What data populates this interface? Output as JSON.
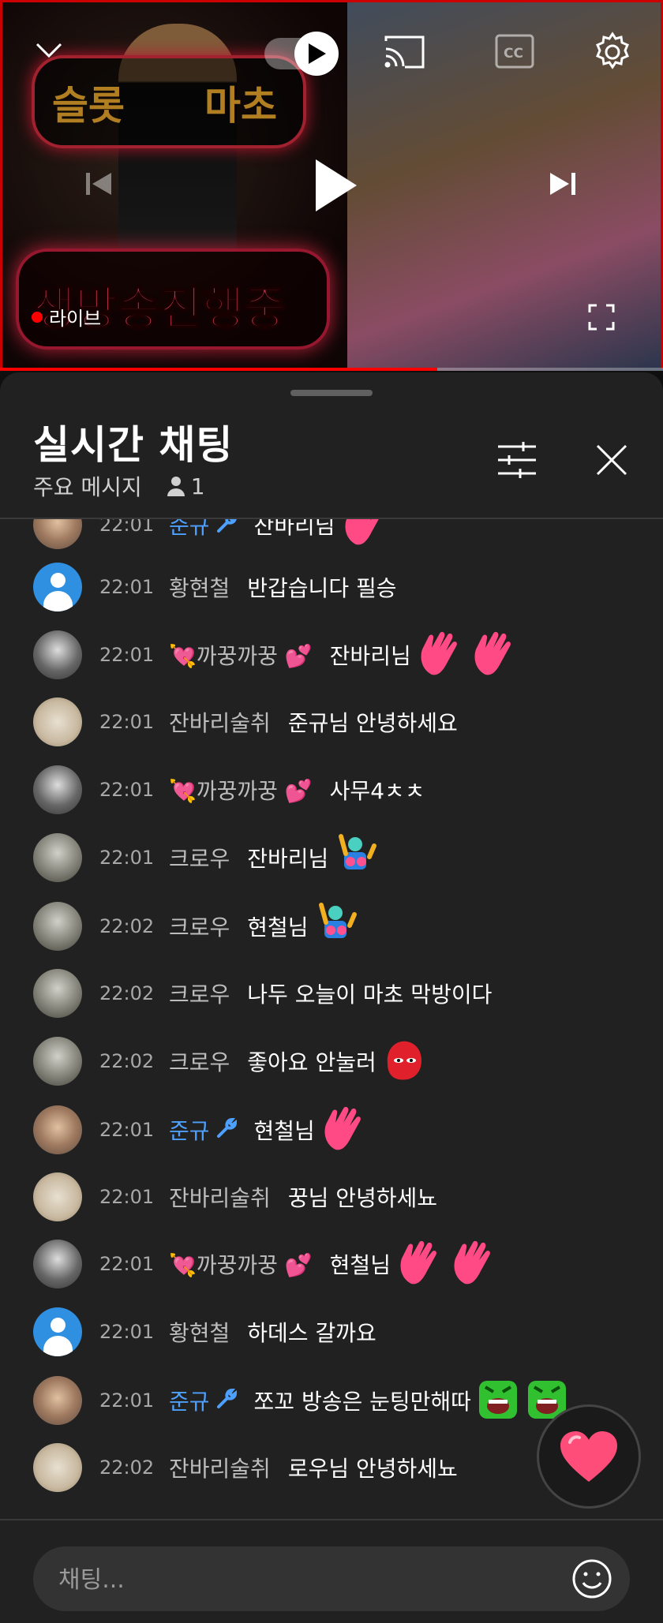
{
  "player": {
    "thumbnail_text_top_left": "슬롯",
    "thumbnail_text_top_right": "마초",
    "thumbnail_text_bottom": "생방송진행중",
    "live_label": "라이브",
    "progress": 0.66,
    "icons": [
      "chevron-down-icon",
      "autoplay-toggle",
      "cast-icon",
      "captions-icon",
      "settings-icon",
      "previous-icon",
      "play-icon",
      "next-icon",
      "fullscreen-icon"
    ]
  },
  "chat": {
    "title": "실시간 채팅",
    "mode_label": "주요 메시지",
    "viewer_count": "1",
    "input_placeholder": "채팅...",
    "messages": [
      {
        "avatar": "av-e",
        "time": "22:01",
        "author": "준규",
        "mod": true,
        "text": "잔바리님",
        "emoji": [
          "wave-hand-emoji"
        ]
      },
      {
        "avatar": "av-default",
        "time": "22:01",
        "author": "황현철",
        "mod": false,
        "text": "반갑습니다 필승",
        "emoji": []
      },
      {
        "avatar": "av-c",
        "time": "22:01",
        "author": "💘까꿍까꿍 💕",
        "mod": false,
        "text": "잔바리님",
        "emoji": [
          "wave-hand-emoji",
          "wave-hand-emoji"
        ]
      },
      {
        "avatar": "av-b",
        "time": "22:01",
        "author": "잔바리술취",
        "mod": false,
        "text": "준규님 안녕하세요",
        "emoji": []
      },
      {
        "avatar": "av-c",
        "time": "22:01",
        "author": "💘까꿍까꿍 💕",
        "mod": false,
        "text": "사무4ㅊㅊ",
        "emoji": []
      },
      {
        "avatar": "av-d",
        "time": "22:01",
        "author": "크로우",
        "mod": false,
        "text": "잔바리님",
        "emoji": [
          "dancing-person-emoji"
        ]
      },
      {
        "avatar": "av-d",
        "time": "22:02",
        "author": "크로우",
        "mod": false,
        "text": "현철님",
        "emoji": [
          "dancing-person-emoji"
        ]
      },
      {
        "avatar": "av-d",
        "time": "22:02",
        "author": "크로우",
        "mod": false,
        "text": "나두 오늘이 마초 막방이다",
        "emoji": []
      },
      {
        "avatar": "av-d",
        "time": "22:02",
        "author": "크로우",
        "mod": false,
        "text": "좋아요 안눌러",
        "emoji": [
          "red-blob-emoji"
        ]
      },
      {
        "avatar": "av-e",
        "time": "22:01",
        "author": "준규",
        "mod": true,
        "text": "현철님",
        "emoji": [
          "wave-hand-emoji"
        ]
      },
      {
        "avatar": "av-b",
        "time": "22:01",
        "author": "잔바리술취",
        "mod": false,
        "text": "꿍님 안녕하세뇨",
        "emoji": []
      },
      {
        "avatar": "av-c",
        "time": "22:01",
        "author": "💘까꿍까꿍 💕",
        "mod": false,
        "text": "현철님",
        "emoji": [
          "wave-hand-emoji",
          "wave-hand-emoji"
        ]
      },
      {
        "avatar": "av-default",
        "time": "22:01",
        "author": "황현철",
        "mod": false,
        "text": "하데스 갈까요",
        "emoji": []
      },
      {
        "avatar": "av-e",
        "time": "22:01",
        "author": "준규",
        "mod": true,
        "text": "쪼꼬 방송은 눈팅만해따",
        "emoji": [
          "green-face-emoji",
          "green-face-emoji"
        ]
      },
      {
        "avatar": "av-b",
        "time": "22:02",
        "author": "잔바리술취",
        "mod": false,
        "text": "로우님 안녕하세뇨",
        "emoji": []
      }
    ]
  },
  "colors": {
    "live_red": "#ff0000",
    "mod_blue": "#4ea0ff",
    "panel_bg": "#212121",
    "heart_pink": "#ff4d7a"
  }
}
